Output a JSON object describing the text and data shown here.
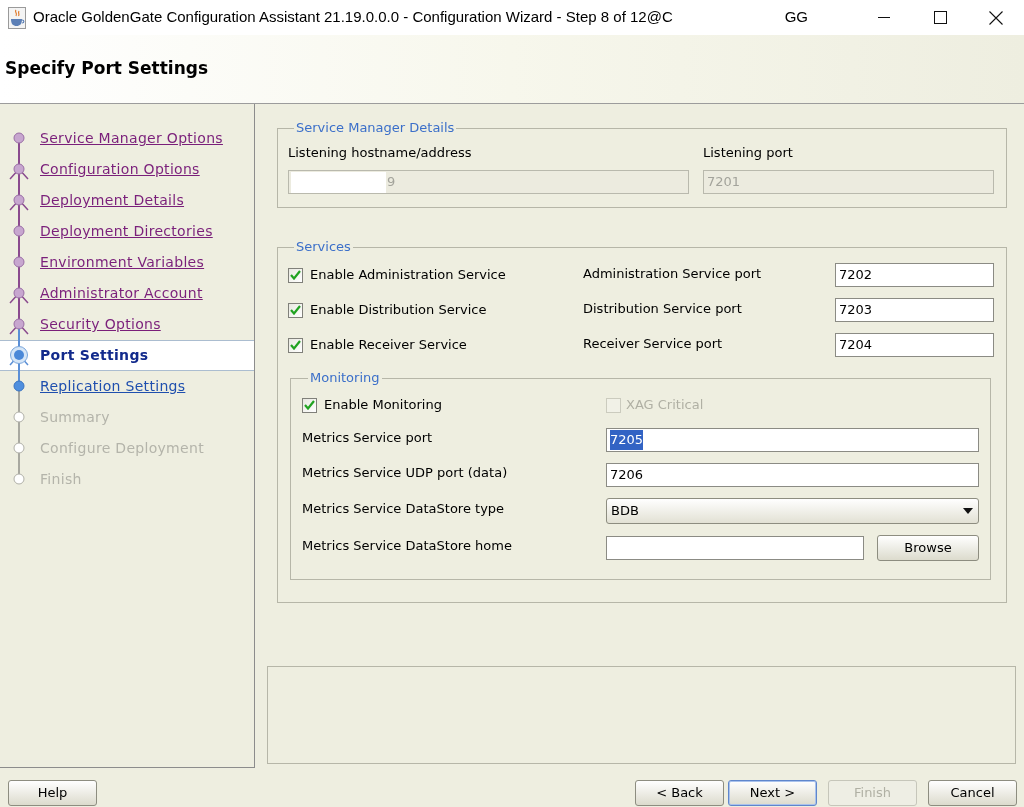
{
  "window": {
    "title": "Oracle GoldenGate Configuration Assistant 21.19.0.0.0 - Configuration Wizard - Step 8 of 12@C",
    "user": "GG"
  },
  "header": {
    "title": "Specify Port Settings"
  },
  "steps": [
    {
      "label": "Service Manager Options",
      "kind": "visited",
      "branch": false,
      "selected": false
    },
    {
      "label": "Configuration Options",
      "kind": "visited",
      "branch": true,
      "selected": false
    },
    {
      "label": "Deployment Details",
      "kind": "visited",
      "branch": true,
      "selected": false
    },
    {
      "label": "Deployment Directories",
      "kind": "visited",
      "branch": false,
      "selected": false
    },
    {
      "label": "Environment Variables",
      "kind": "visited",
      "branch": false,
      "selected": false
    },
    {
      "label": "Administrator Account",
      "kind": "visited",
      "branch": true,
      "selected": false
    },
    {
      "label": "Security Options",
      "kind": "visited",
      "branch": true,
      "selected": false
    },
    {
      "label": "Port Settings",
      "kind": "current",
      "branch": true,
      "selected": true
    },
    {
      "label": "Replication Settings",
      "kind": "available",
      "branch": false,
      "selected": false
    },
    {
      "label": "Summary",
      "kind": "pending",
      "branch": false,
      "selected": false
    },
    {
      "label": "Configure Deployment",
      "kind": "pending",
      "branch": false,
      "selected": false
    },
    {
      "label": "Finish",
      "kind": "pending",
      "branch": false,
      "selected": false
    }
  ],
  "service_manager": {
    "title": "Service Manager Details",
    "host": {
      "label": "Listening hostname/address",
      "value": "9",
      "disabled": true,
      "redacted": true
    },
    "port": {
      "label": "Listening port",
      "value": "7201",
      "disabled": true
    }
  },
  "services": {
    "title": "Services",
    "rows": [
      {
        "label": "Enable Administration Service",
        "checked": true,
        "port_label": "Administration Service port",
        "port": "7202"
      },
      {
        "label": "Enable Distribution Service",
        "checked": true,
        "port_label": "Distribution Service port",
        "port": "7203"
      },
      {
        "label": "Enable Receiver Service",
        "checked": true,
        "port_label": "Receiver Service port",
        "port": "7204"
      }
    ]
  },
  "monitoring": {
    "title": "Monitoring",
    "enable": {
      "label": "Enable Monitoring",
      "checked": true,
      "disabled": false
    },
    "xag": {
      "label": "XAG Critical",
      "checked": false,
      "disabled": true
    },
    "fields": [
      {
        "kind": "text",
        "label": "Metrics Service port",
        "value": "7205",
        "text_selected": true
      },
      {
        "kind": "text",
        "label": "Metrics Service UDP port (data)",
        "value": "7206",
        "text_selected": false
      },
      {
        "kind": "dropdown",
        "label": "Metrics Service DataStore type",
        "value": "BDB"
      },
      {
        "kind": "browse",
        "label": "Metrics Service DataStore home",
        "button": "Browse"
      }
    ]
  },
  "buttons": {
    "left": [
      {
        "label": "Help",
        "disabled": false,
        "default": false
      }
    ],
    "right": [
      {
        "label": "< Back",
        "disabled": false,
        "default": false
      },
      {
        "label": "Next >",
        "disabled": false,
        "default": true
      },
      {
        "label": "Finish",
        "disabled": true,
        "default": false
      },
      {
        "label": "Cancel",
        "disabled": false,
        "default": false
      }
    ]
  }
}
